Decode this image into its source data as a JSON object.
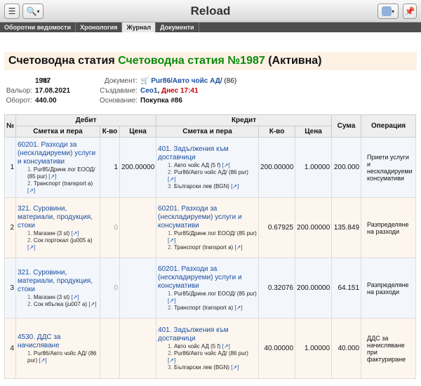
{
  "topbar": {
    "title": "Reload",
    "pin_label": "✎"
  },
  "tabs": [
    "Оборотни ведомости",
    "Хронология",
    "Журнал",
    "Документи"
  ],
  "heading": {
    "prefix": "Счетоводна статия",
    "title": "Счетоводна статия №1987",
    "status": "(Активна)"
  },
  "meta": {
    "no_label": "№:",
    "no_value": "1987",
    "valor_label": "Вальор:",
    "valor_value": "17.08.2021",
    "turnover_label": "Оборот:",
    "turnover_value": "440.00",
    "doc_label": "Документ:",
    "doc_value": "Pur86/Авто чойс АД/",
    "doc_extra": "(86)",
    "created_label": "Създаване:",
    "created_user": "Ceo1",
    "created_when": "Днес 17:41",
    "basis_label": "Основание:",
    "basis_value": "Покупка #86"
  },
  "table": {
    "h_no": "№",
    "h_debit": "Дебит",
    "h_credit": "Кредит",
    "h_sum": "Сума",
    "h_op": "Операция",
    "h_acc": "Сметка и пера",
    "h_qty": "К-во",
    "h_price": "Цена",
    "ext": "[↗]",
    "rows": [
      {
        "no": "1",
        "d_acc": "60201. Разходи за (нескладируеми) услуги и консумативи",
        "d_items": [
          "Pur85/Дринк лог ЕООД/ (85 pur)",
          "Транспорт (transport a)"
        ],
        "d_qty": "1",
        "d_price": "200.00000",
        "c_acc": "401. Задължения към доставчици",
        "c_items": [
          "Авто чойс АД (5 f)",
          "Pur86/Авто чойс АД/ (86 pur)",
          "Български лев (BGN)"
        ],
        "c_qty": "200.00000",
        "c_price": "1.00000",
        "sum": "200.000",
        "op": "Приети услуги и нескладируеми консумативи"
      },
      {
        "no": "2",
        "d_acc": "321. Суровини, материали, продукция, стоки",
        "d_items": [
          "Магазин (3 st)",
          "Сок портокал (ju005 a)"
        ],
        "d_qty": "0",
        "d_price": "",
        "c_acc": "60201. Разходи за (нескладируеми) услуги и консумативи",
        "c_items": [
          "Pur85/Дринк лог ЕООД/ (85 pur)",
          "Транспорт (transport a)"
        ],
        "c_qty": "0.67925",
        "c_price": "200.00000",
        "sum": "135.849",
        "op": "Разпределяне на разходи"
      },
      {
        "no": "3",
        "d_acc": "321. Суровини, материали, продукция, стоки",
        "d_items": [
          "Магазин (3 st)",
          "Сок ябълка (ju007 a)"
        ],
        "d_qty": "0",
        "d_price": "",
        "c_acc": "60201. Разходи за (нескладируеми) услуги и консумативи",
        "c_items": [
          "Pur85/Дринк лог ЕООД/ (85 pur)",
          "Транспорт (transport a)"
        ],
        "c_qty": "0.32076",
        "c_price": "200.00000",
        "sum": "64.151",
        "op": "Разпределяне на разходи"
      },
      {
        "no": "4",
        "d_acc": "4530. ДДС за начисляване",
        "d_items": [
          "Pur86/Авто чойс АД/ (86 pur)"
        ],
        "d_qty": "",
        "d_price": "",
        "c_acc": "401. Задължения към доставчици",
        "c_items": [
          "Авто чойс АД (5 f)",
          "Pur86/Авто чойс АД/ (86 pur)",
          "Български лев (BGN)"
        ],
        "c_qty": "40.00000",
        "c_price": "1.00000",
        "sum": "40.000",
        "op": "ДДС за начисляване при фактуриране"
      }
    ]
  }
}
